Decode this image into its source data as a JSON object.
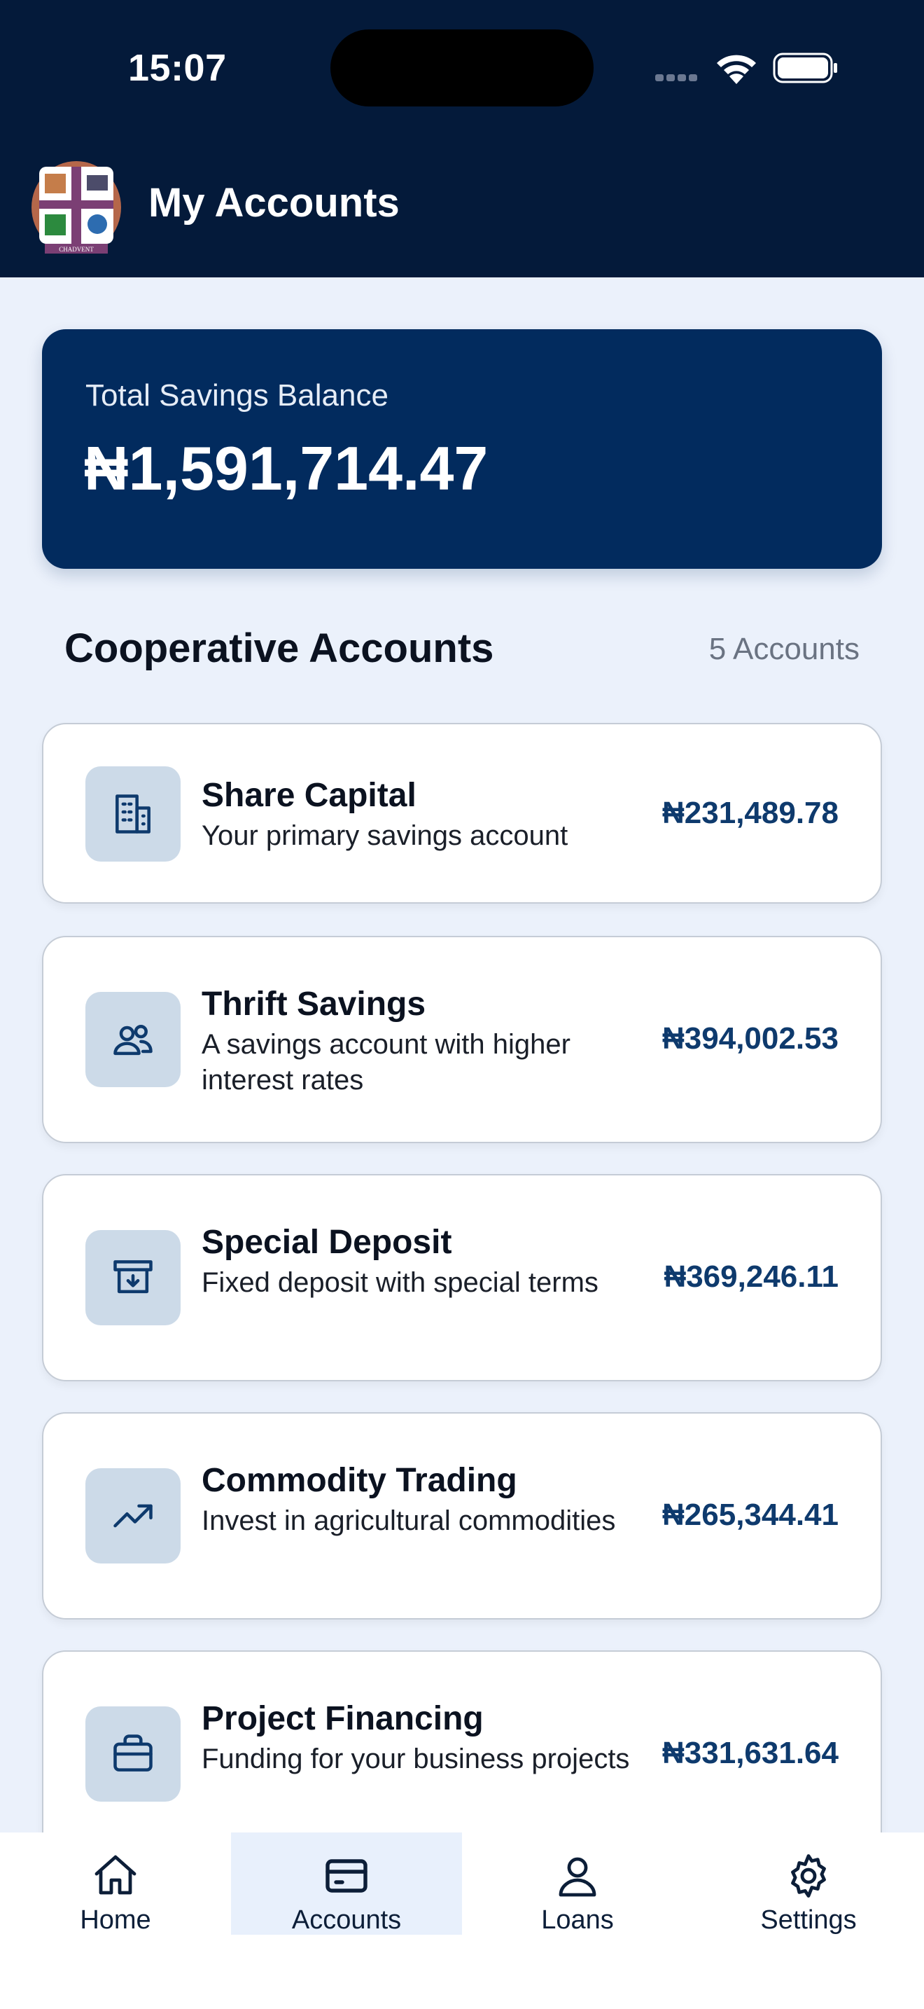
{
  "status": {
    "time": "15:07"
  },
  "header": {
    "title": "My Accounts",
    "logo_text": "CHADVENT"
  },
  "balance": {
    "label": "Total Savings Balance",
    "value": "₦1,591,714.47"
  },
  "section": {
    "title": "Cooperative Accounts",
    "count": "5 Accounts"
  },
  "accounts": [
    {
      "icon": "building-icon",
      "title": "Share Capital",
      "desc": "Your primary savings account",
      "amount": "₦231,489.78"
    },
    {
      "icon": "users-icon",
      "title": "Thrift Savings",
      "desc": "A savings account with higher interest rates",
      "amount": "₦394,002.53"
    },
    {
      "icon": "archive-icon",
      "title": "Special Deposit",
      "desc": "Fixed deposit with special terms",
      "amount": "₦369,246.11"
    },
    {
      "icon": "trending-up-icon",
      "title": "Commodity Trading",
      "desc": "Invest in agricultural commodities",
      "amount": "₦265,344.41"
    },
    {
      "icon": "briefcase-icon",
      "title": "Project Financing",
      "desc": "Funding for your business projects",
      "amount": "₦331,631.64"
    }
  ],
  "tabs": [
    {
      "label": "Home",
      "icon": "home-icon"
    },
    {
      "label": "Accounts",
      "icon": "card-icon",
      "active": true
    },
    {
      "label": "Loans",
      "icon": "user-icon"
    },
    {
      "label": "Settings",
      "icon": "gear-icon"
    }
  ],
  "colors": {
    "header": "#041a3a",
    "card": "#022b5e",
    "amount": "#0e3a6d",
    "background": "#ebf1fb"
  }
}
